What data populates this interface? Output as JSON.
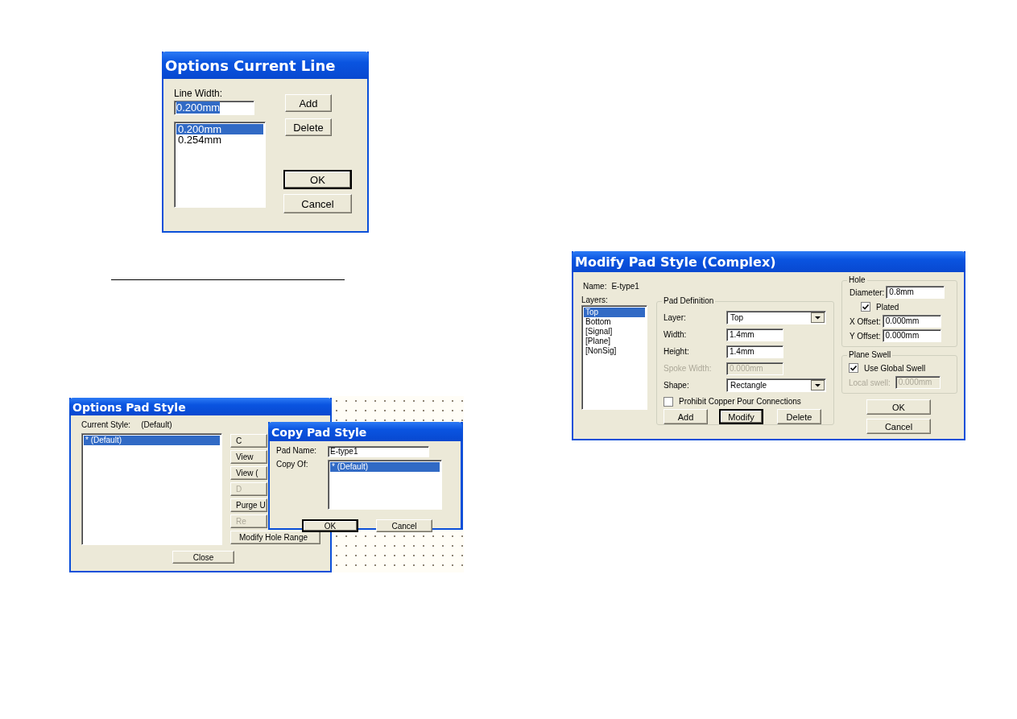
{
  "options_current_line": {
    "title": "Options Current Line",
    "line_width_label": "Line Width:",
    "line_width_value": "0.200mm",
    "value_selected": true,
    "widths": [
      {
        "label": "0.200mm",
        "selected": true
      },
      {
        "label": "0.254mm",
        "selected": false
      }
    ],
    "side_buttons": [
      {
        "label": "Add"
      },
      {
        "label": "Delete"
      }
    ],
    "buttons": [
      {
        "label": "OK",
        "default": true
      },
      {
        "label": "Cancel",
        "default": false
      }
    ]
  },
  "options_pad_style": {
    "title": "Options Pad Style",
    "current_style_label": "Current Style:",
    "current_style_value": "(Default)",
    "styles": [
      {
        "label": "* (Default)",
        "selected": true
      }
    ],
    "buttons": [
      {
        "label": "C",
        "disabled": false
      },
      {
        "label": "View",
        "disabled": false
      },
      {
        "label": "View (",
        "disabled": false
      },
      {
        "label": "D",
        "disabled": true
      },
      {
        "label": "Purge U",
        "disabled": false
      },
      {
        "label": "Re",
        "disabled": true
      },
      {
        "label": "Modify Hole Range",
        "disabled": false
      }
    ],
    "close_button": "Close"
  },
  "copy_pad_style": {
    "title": "Copy Pad Style",
    "pad_name_label": "Pad Name:",
    "pad_name_value": "E-type1",
    "copy_of_label": "Copy Of:",
    "sources": [
      {
        "label": "* (Default)",
        "selected": true
      }
    ],
    "buttons": [
      {
        "label": "OK",
        "default": true
      },
      {
        "label": "Cancel",
        "default": false
      }
    ]
  },
  "modify_pad_style": {
    "title": "Modify Pad Style (Complex)",
    "name_label": "Name:",
    "name_value": "E-type1",
    "layers_label": "Layers:",
    "layers": [
      {
        "label": "Top",
        "selected": true
      },
      {
        "label": "Bottom",
        "selected": false
      },
      {
        "label": "[Signal]",
        "selected": false
      },
      {
        "label": "[Plane]",
        "selected": false
      },
      {
        "label": "[NonSig]",
        "selected": false
      }
    ],
    "pad_definition": {
      "title": "Pad Definition",
      "fields": [
        {
          "kind": "dropdown",
          "label": "Layer:",
          "value": "Top",
          "disabled": false
        },
        {
          "kind": "text",
          "label": "Width:",
          "value": "1.4mm",
          "disabled": false
        },
        {
          "kind": "text",
          "label": "Height:",
          "value": "1.4mm",
          "disabled": false
        },
        {
          "kind": "text",
          "label": "Spoke Width:",
          "value": "0.000mm",
          "disabled": true
        },
        {
          "kind": "dropdown",
          "label": "Shape:",
          "value": "Rectangle",
          "disabled": false
        }
      ],
      "prohibit": {
        "label": "Prohibit Copper Pour Connections",
        "checked": false
      },
      "buttons": [
        {
          "label": "Add",
          "default": false
        },
        {
          "label": "Modify",
          "default": true
        },
        {
          "label": "Delete",
          "default": false
        }
      ]
    },
    "hole": {
      "title": "Hole",
      "rows": [
        {
          "kind": "text",
          "label": "Diameter:",
          "value": "0.8mm"
        },
        {
          "kind": "checkbox",
          "label": "Plated",
          "checked": true
        },
        {
          "kind": "text",
          "label": "X Offset:",
          "value": "0.000mm"
        },
        {
          "kind": "text",
          "label": "Y Offset:",
          "value": "0.000mm"
        }
      ]
    },
    "plane_swell": {
      "title": "Plane Swell",
      "use_global": {
        "label": "Use Global Swell",
        "checked": true
      },
      "local": {
        "label": "Local swell:",
        "value": "0.000mm",
        "disabled": true
      }
    },
    "buttons": [
      {
        "label": "OK",
        "default": false
      },
      {
        "label": "Cancel",
        "default": false
      }
    ]
  }
}
